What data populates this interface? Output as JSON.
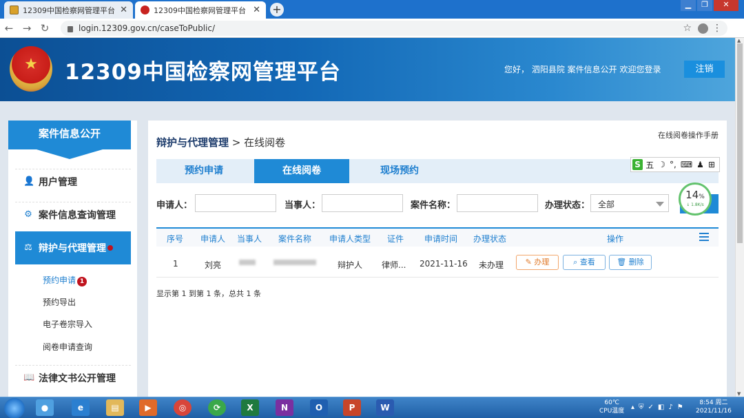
{
  "browser": {
    "tabs": [
      {
        "title": "12309中国检察网管理平台",
        "active": false
      },
      {
        "title": "12309中国检察网管理平台",
        "active": true
      }
    ],
    "url": "login.12309.gov.cn/caseToPublic/"
  },
  "header": {
    "site_title": "12309中国检察网管理平台",
    "welcome": "您好，  泗阳县院  案件信息公开  欢迎您登录",
    "logout_label": "注销"
  },
  "sidebar": {
    "title": "案件信息公开",
    "items": [
      {
        "label": "用户管理",
        "icon": "user-icon"
      },
      {
        "label": "案件信息查询管理",
        "icon": "search-icon"
      },
      {
        "label": "辩护与代理管理",
        "icon": "lawyer-icon",
        "active": true
      },
      {
        "label": "法律文书公开管理",
        "icon": "book-icon"
      }
    ],
    "subitems": [
      {
        "label": "预约申请",
        "badge": "1",
        "current": true
      },
      {
        "label": "预约导出"
      },
      {
        "label": "电子卷宗导入"
      },
      {
        "label": "阅卷申请查询"
      }
    ]
  },
  "main": {
    "breadcrumb_parent": "辩护与代理管理",
    "breadcrumb_sep": ">",
    "breadcrumb_current": "在线阅卷",
    "manual_link": "在线阅卷操作手册",
    "tabs": [
      {
        "label": "预约申请",
        "active": false
      },
      {
        "label": "在线阅卷",
        "active": true
      },
      {
        "label": "现场预约",
        "active": false
      }
    ],
    "filters": {
      "applicant_label": "申请人：",
      "party_label": "当事人：",
      "case_name_label": "案件名称：",
      "status_label": "办理状态：",
      "status_value": "全部"
    },
    "table": {
      "headers": [
        "序号",
        "申请人",
        "当事人",
        "案件名称",
        "申请人类型",
        "证件",
        "申请时间",
        "办理状态",
        "操作"
      ],
      "rows": [
        {
          "index": "1",
          "applicant": "刘亮",
          "type": "辩护人",
          "cert": "律师...",
          "time": "2021-11-16",
          "status": "未办理"
        }
      ],
      "actions": [
        "办理",
        "查看",
        "删除"
      ]
    },
    "pager": "显示第 1 到第 1 条，总共 1 条"
  },
  "ime": {
    "mode": "五"
  },
  "speed_widget": {
    "percent": "14",
    "unit": "%",
    "rate": "↓ 1.8K/s"
  },
  "taskbar": {
    "temp": "60℃",
    "temp_label": "CPU温度",
    "time": "8:54 周二",
    "date": "2021/11/16"
  }
}
